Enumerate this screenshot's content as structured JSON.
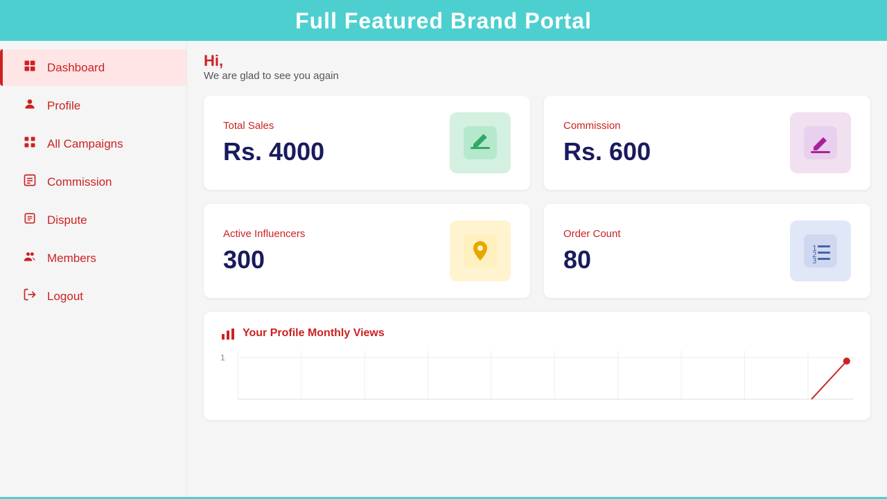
{
  "app": {
    "title": "Full Featured Brand Portal"
  },
  "header": {
    "greeting": "Hi,",
    "subgreeting": "We are glad to see you again"
  },
  "sidebar": {
    "items": [
      {
        "id": "dashboard",
        "label": "Dashboard",
        "icon": "dashboard",
        "active": true
      },
      {
        "id": "profile",
        "label": "Profile",
        "icon": "profile",
        "active": false
      },
      {
        "id": "all-campaigns",
        "label": "All Campaigns",
        "icon": "campaigns",
        "active": false
      },
      {
        "id": "commission",
        "label": "Commission",
        "icon": "commission",
        "active": false
      },
      {
        "id": "dispute",
        "label": "Dispute",
        "icon": "dispute",
        "active": false
      },
      {
        "id": "members",
        "label": "Members",
        "icon": "members",
        "active": false
      },
      {
        "id": "logout",
        "label": "Logout",
        "icon": "logout",
        "active": false
      }
    ]
  },
  "stats": {
    "total_sales": {
      "label": "Total Sales",
      "value": "Rs. 4000",
      "icon_color": "green"
    },
    "commission": {
      "label": "Commission",
      "value": "Rs. 600",
      "icon_color": "purple"
    },
    "active_influencers": {
      "label": "Active Influencers",
      "value": "300",
      "icon_color": "yellow"
    },
    "order_count": {
      "label": "Order Count",
      "value": "80",
      "icon_color": "blue"
    }
  },
  "chart": {
    "title": "Your Profile Monthly Views",
    "y_label": "1"
  }
}
